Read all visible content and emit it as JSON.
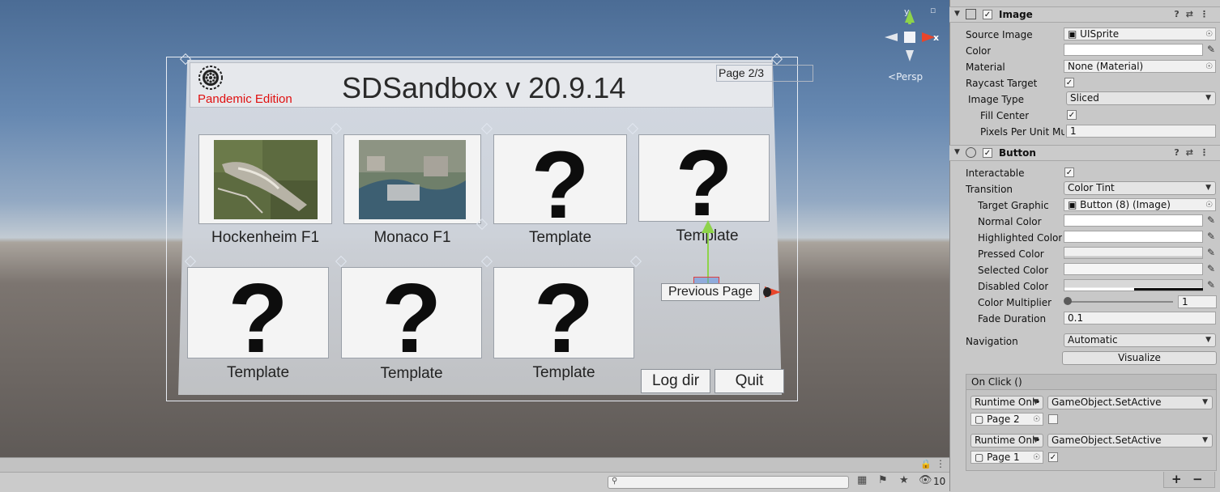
{
  "scene": {
    "edition": "Pandemic Edition",
    "title": "SDSandbox v 20.9.14",
    "page_indicator": "Page 2/3",
    "tiles": [
      {
        "label": "Hockenheim F1"
      },
      {
        "label": "Monaco F1"
      },
      {
        "label": "Template",
        "glyph": "?"
      },
      {
        "label": "Template",
        "glyph": "?"
      },
      {
        "label": "Template",
        "glyph": "?"
      },
      {
        "label": "Template",
        "glyph": "?"
      },
      {
        "label": "Template",
        "glyph": "?"
      }
    ],
    "previous_page_label": "Previous Page",
    "log_dir_label": "Log dir",
    "quit_label": "Quit",
    "gizmo": {
      "y_label": "y",
      "x_label": "x",
      "persp_label": "Persp"
    },
    "bottom": {
      "hidden_count": "10"
    }
  },
  "inspector": {
    "image": {
      "title": "Image",
      "source_image_label": "Source Image",
      "source_image_value": "UISprite",
      "color_label": "Color",
      "material_label": "Material",
      "material_value": "None (Material)",
      "raycast_target_label": "Raycast Target",
      "image_type_label": "Image Type",
      "image_type_value": "Sliced",
      "fill_center_label": "Fill Center",
      "pixels_per_unit_label": "Pixels Per Unit Mul",
      "pixels_per_unit_value": "1"
    },
    "button": {
      "title": "Button",
      "interactable_label": "Interactable",
      "transition_label": "Transition",
      "transition_value": "Color Tint",
      "target_graphic_label": "Target Graphic",
      "target_graphic_value": "Button (8) (Image)",
      "normal_color_label": "Normal Color",
      "highlighted_color_label": "Highlighted Color",
      "pressed_color_label": "Pressed Color",
      "selected_color_label": "Selected Color",
      "disabled_color_label": "Disabled Color",
      "color_multiplier_label": "Color Multiplier",
      "color_multiplier_value": "1",
      "fade_duration_label": "Fade Duration",
      "fade_duration_value": "0.1",
      "navigation_label": "Navigation",
      "navigation_value": "Automatic",
      "visualize_label": "Visualize"
    },
    "on_click": {
      "title": "On Click ()",
      "entries": [
        {
          "mode": "Runtime Onl•",
          "function": "GameObject.SetActive",
          "object": "Page 2",
          "checked": false
        },
        {
          "mode": "Runtime Onl•",
          "function": "GameObject.SetActive",
          "object": "Page 1",
          "checked": true
        }
      ],
      "add_label": "+",
      "remove_label": "−"
    }
  },
  "colors": {
    "edition_red": "#e01010",
    "gizmo_y": "#8ed34a",
    "gizmo_x": "#e8452a"
  }
}
